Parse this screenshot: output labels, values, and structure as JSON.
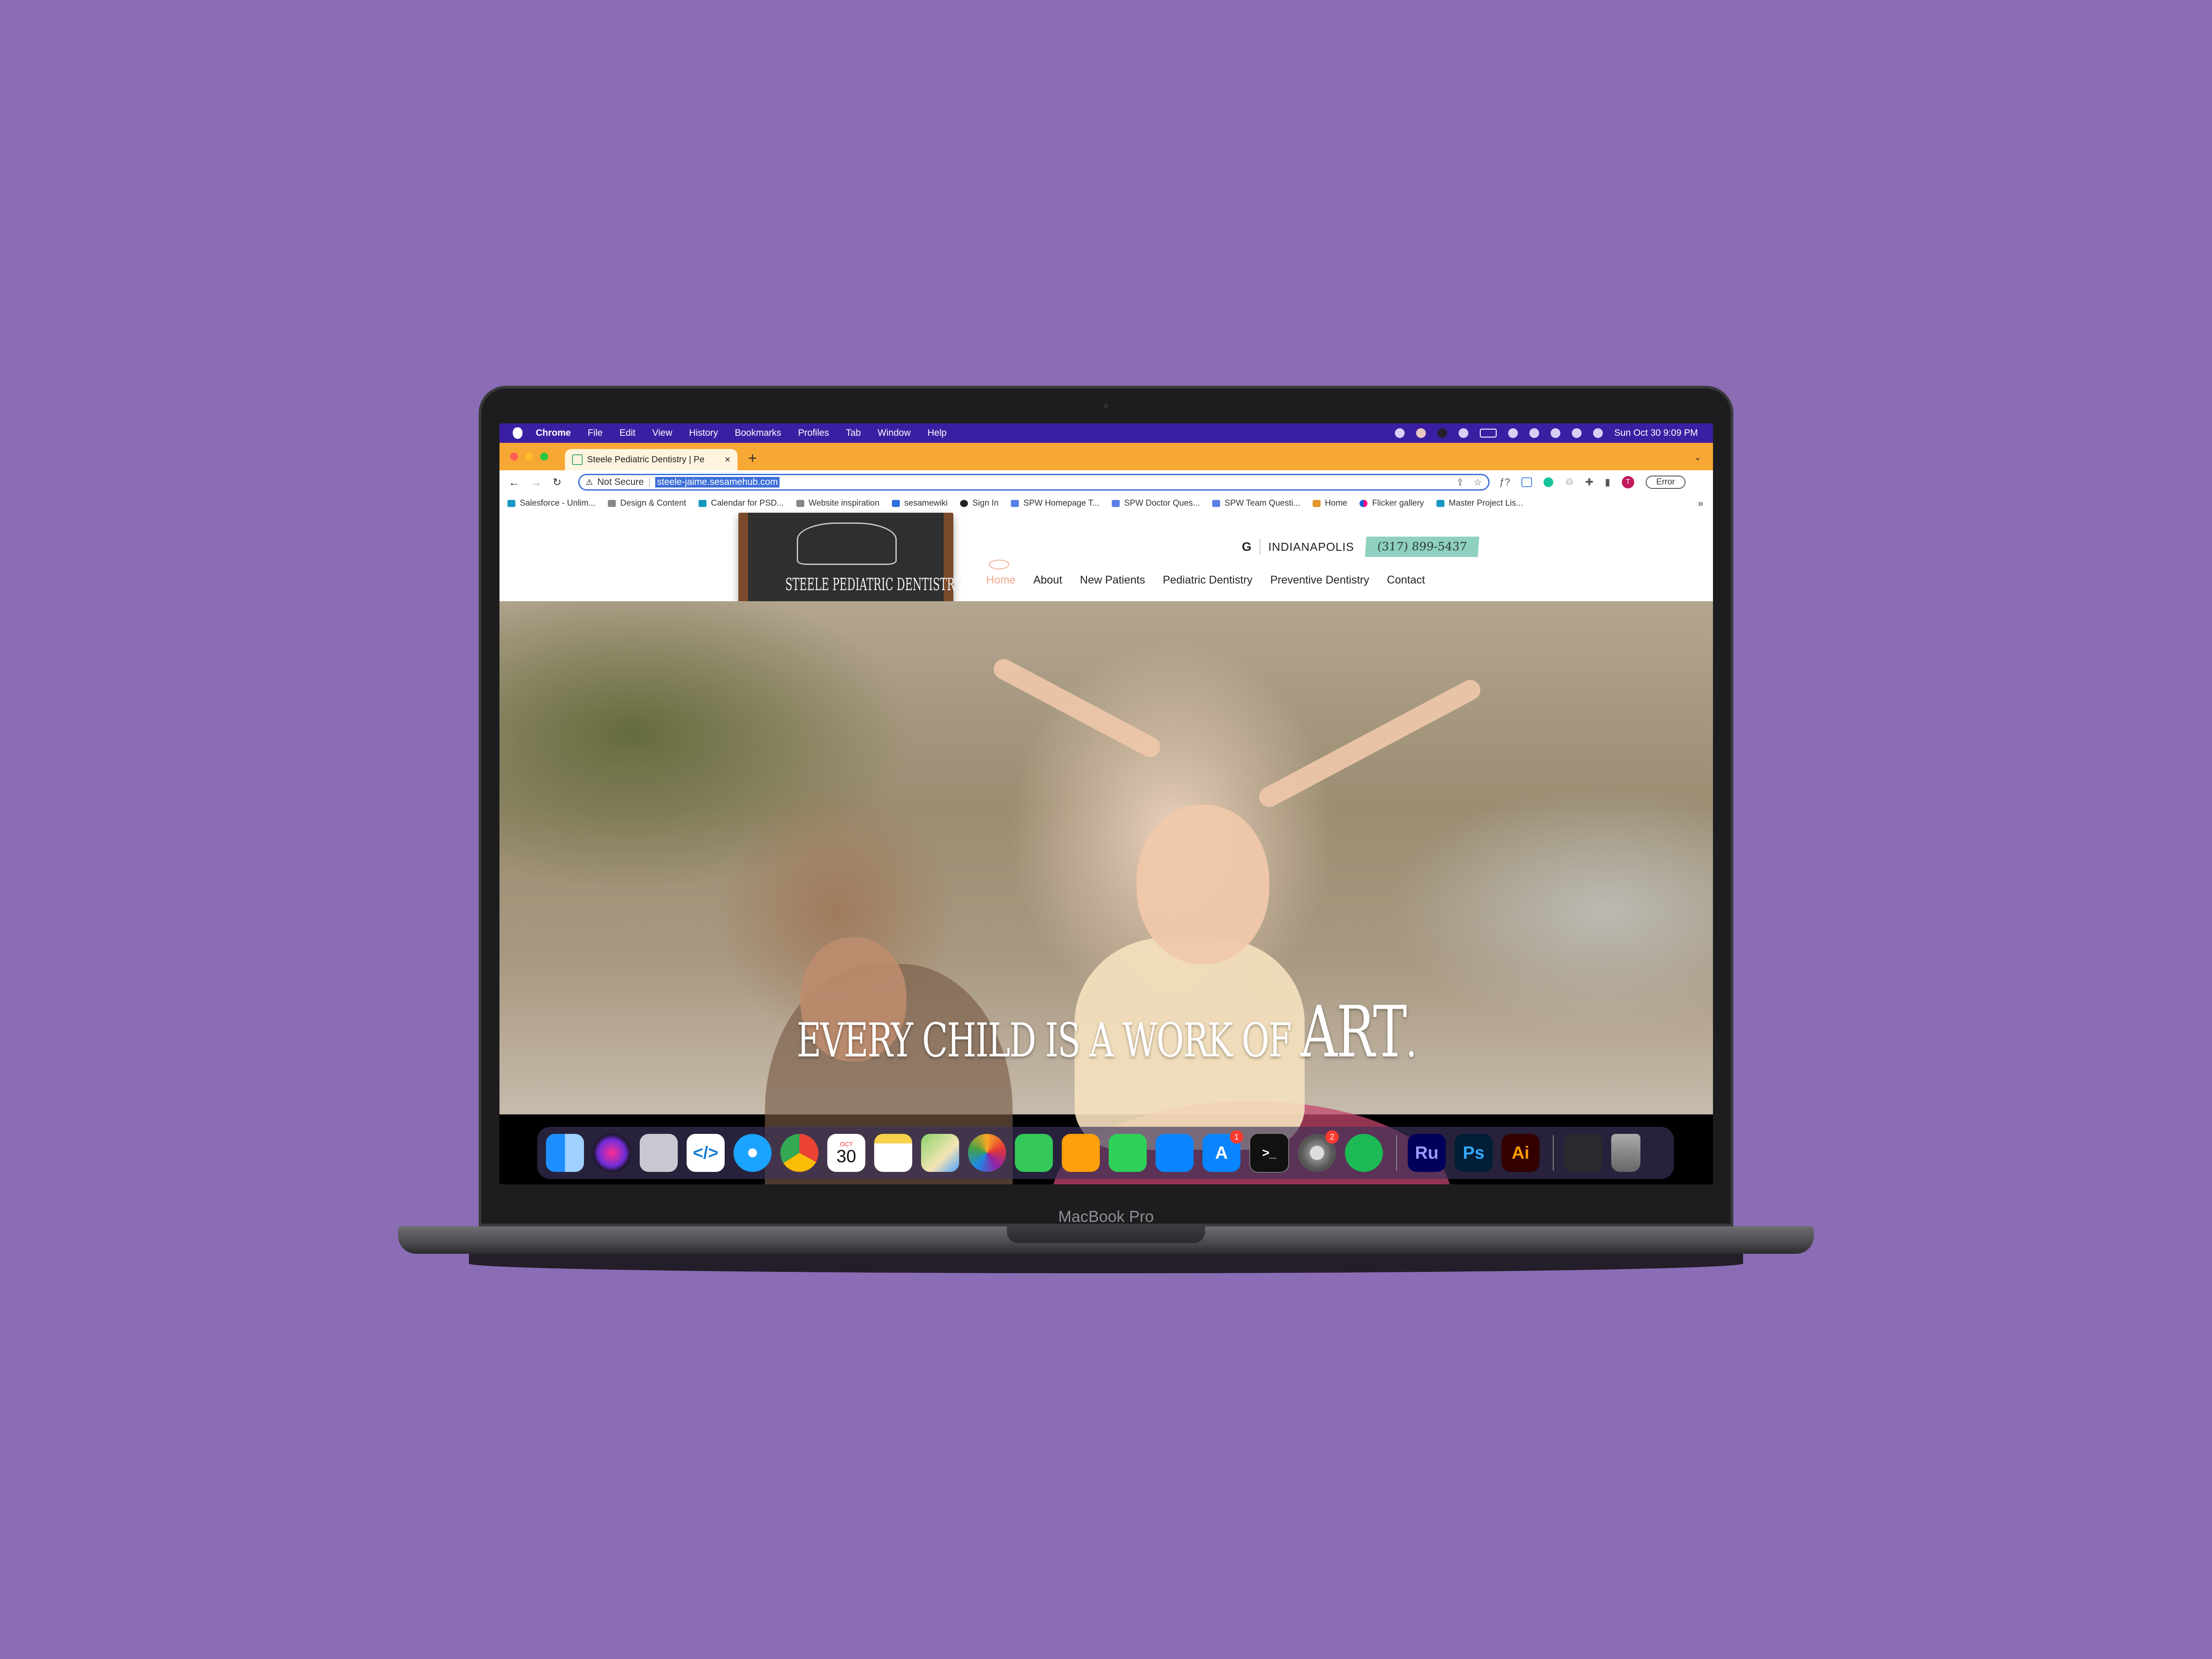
{
  "device": {
    "label": "MacBook Pro"
  },
  "menubar": {
    "app": "Chrome",
    "items": [
      "File",
      "Edit",
      "View",
      "History",
      "Bookmarks",
      "Profiles",
      "Tab",
      "Window",
      "Help"
    ],
    "clock": "Sun Oct 30  9:09 PM"
  },
  "browser": {
    "tab_title": "Steele Pediatric Dentistry | Pe",
    "new_tab": "+",
    "security": "Not Secure",
    "url": "steele-jaime.sesamehub.com",
    "profile_initial": "T",
    "error_label": "Error",
    "bookmarks": [
      "Salesforce - Unlim...",
      "Design & Content",
      "Calendar for PSD...",
      "Website inspiration",
      "sesamewiki",
      "Sign In",
      "SPW Homepage T...",
      "SPW Doctor Ques...",
      "SPW Team Questi...",
      "Home",
      "Flicker gallery",
      "Master Project Lis..."
    ],
    "more_bookmarks": "»"
  },
  "site": {
    "logo_text": "STEELE PEDIATRIC DENTISTRY",
    "google_letter": "G",
    "location": "INDIANAPOLIS",
    "phone": "(317) 899-5437",
    "nav": [
      "Home",
      "About",
      "New Patients",
      "Pediatric Dentistry",
      "Preventive Dentistry",
      "Contact"
    ],
    "hero_tagline": "EVERY CHILD IS A WORK OF",
    "hero_emphasis": "ART",
    "hero_period": "."
  },
  "dock": {
    "calendar_month": "OCT",
    "calendar_day": "30",
    "appstore_badge": "1",
    "settings_badge": "2",
    "ru_label": "Ru",
    "ps_label": "Ps",
    "ai_label": "Ai"
  },
  "colors": {
    "background": "#8a6db5",
    "menubar": "#3b1fa3",
    "tabstrip": "#f7a733",
    "nav_active": "#f0a98c",
    "phone_badge": "#8fd0c0"
  }
}
